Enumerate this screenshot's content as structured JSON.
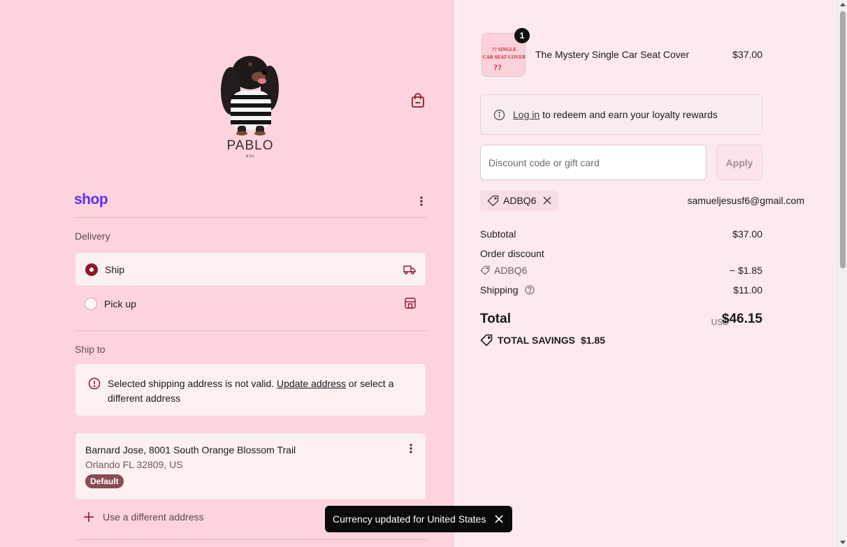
{
  "brand": {
    "logo_text": "PABLO",
    "logo_sub": "& Co."
  },
  "account": {
    "shop_logo": "shop",
    "email": "samueljesusf6@gmail.com"
  },
  "delivery": {
    "label": "Delivery",
    "options": [
      {
        "label": "Ship",
        "selected": true
      },
      {
        "label": "Pick up",
        "selected": false
      }
    ]
  },
  "ship_to": {
    "label": "Ship to",
    "alert": {
      "text_before": "Selected shipping address is not valid.",
      "link": "Update address",
      "text_after": "or select a different address"
    },
    "address": {
      "line1": "Barnard Jose, 8001 South Orange Blossom Trail",
      "line2": "Orlando FL 32809, US",
      "badge": "Default"
    },
    "use_different": "Use a different address"
  },
  "toast": {
    "text": "Currency updated for United States"
  },
  "cart": {
    "item": {
      "name": "The Mystery Single Car Seat Cover",
      "price": "$37.00",
      "quantity": "1",
      "thumb_text": "?? SINGLE CAR SEAT COVER ??"
    },
    "loyalty": {
      "link": "Log in",
      "text": "to redeem and earn your loyalty rewards"
    },
    "discount": {
      "placeholder": "Discount code or gift card",
      "apply": "Apply",
      "code": "ADBQ6"
    },
    "summary": {
      "subtotal_label": "Subtotal",
      "subtotal": "$37.00",
      "order_discount_label": "Order discount",
      "discount_code": "ADBQ6",
      "discount_value": "− $1.85",
      "shipping_label": "Shipping",
      "shipping": "$11.00",
      "total_label": "Total",
      "currency": "USD",
      "total": "$46.15",
      "savings_label": "TOTAL SAVINGS",
      "savings": "$1.85"
    }
  },
  "colors": {
    "accent": "#8b1a2b",
    "shop_purple": "#5a31f4",
    "left_bg": "#fdd3dd",
    "right_bg": "#fdeaf0"
  }
}
